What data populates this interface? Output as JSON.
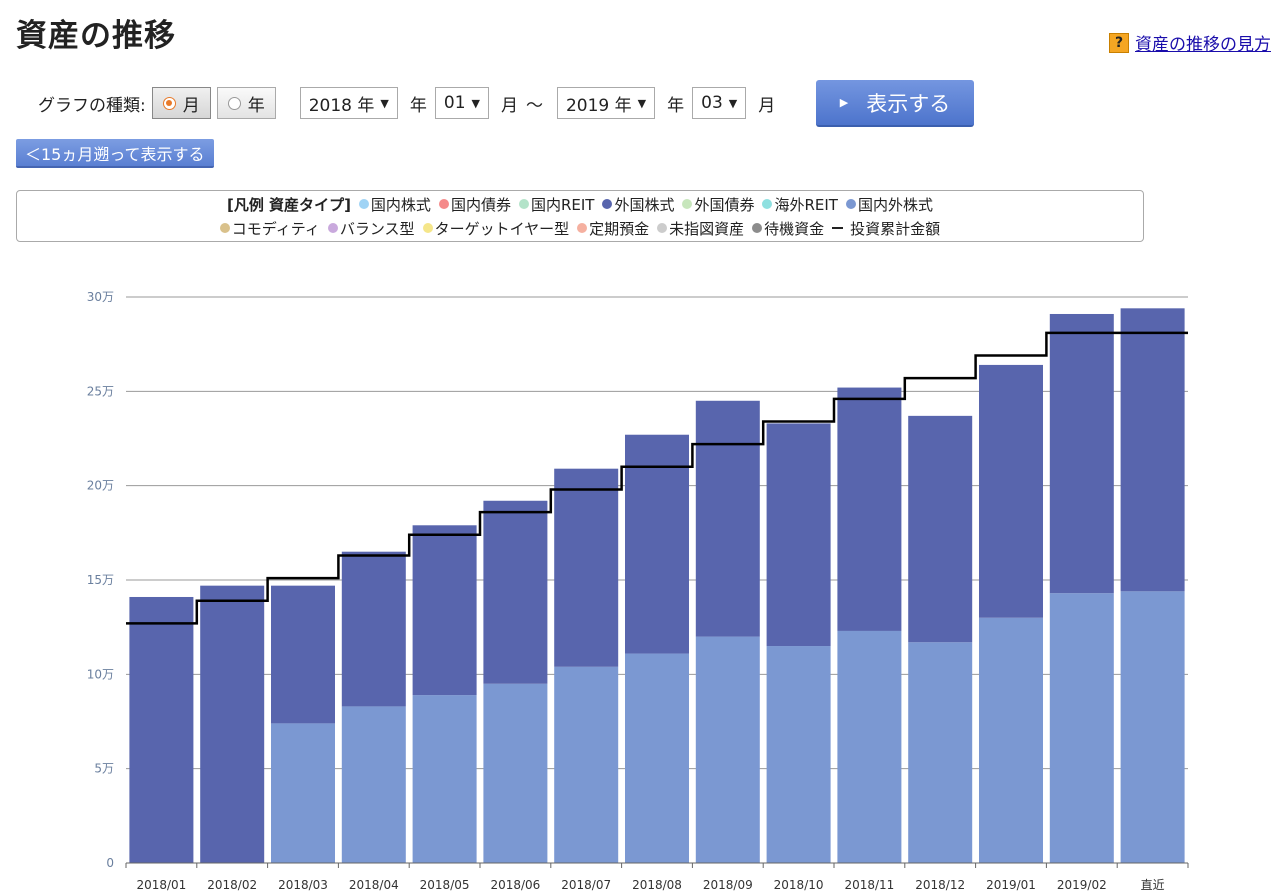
{
  "page": {
    "title": "資産の推移",
    "help_link": "資産の推移の見方",
    "help_icon": "question-icon"
  },
  "controls": {
    "graph_type_label": "グラフの種類:",
    "radio_month": "月",
    "radio_year": "年",
    "selected_type": "月",
    "from_year": "2018 年",
    "from_year_unit": "年",
    "from_month": "01",
    "from_month_unit": "月",
    "range_separator": "～",
    "to_year": "2019 年",
    "to_year_unit": "年",
    "to_month": "03",
    "to_month_unit": "月",
    "show_button": "表示する",
    "back_button": "＜15ヵ月遡って表示する"
  },
  "legend": {
    "title": "[凡例 資産タイプ]",
    "items": [
      {
        "label": "国内株式",
        "color": "#9fd3f5"
      },
      {
        "label": "国内債券",
        "color": "#f58a8a"
      },
      {
        "label": "国内REIT",
        "color": "#b3e3c9"
      },
      {
        "label": "外国株式",
        "color": "#5865ad"
      },
      {
        "label": "外国債券",
        "color": "#c7e6bc"
      },
      {
        "label": "海外REIT",
        "color": "#8fe0e0"
      },
      {
        "label": "国内外株式",
        "color": "#7b98d2"
      },
      {
        "label": "コモディティ",
        "color": "#d9c18b"
      },
      {
        "label": "バランス型",
        "color": "#c9a9dd"
      },
      {
        "label": "ターゲットイヤー型",
        "color": "#f5e68a"
      },
      {
        "label": "定期預金",
        "color": "#f5b0a0"
      },
      {
        "label": "未指図資産",
        "color": "#cccccc"
      },
      {
        "label": "待機資金",
        "color": "#8c8c8c"
      }
    ],
    "line_item": "投資累計金額"
  },
  "chart_data": {
    "type": "bar",
    "stacked": true,
    "categories": [
      "2018/01",
      "2018/02",
      "2018/03",
      "2018/04",
      "2018/05",
      "2018/06",
      "2018/07",
      "2018/08",
      "2018/09",
      "2018/10",
      "2018/11",
      "2018/12",
      "2019/01",
      "2019/02",
      "直近"
    ],
    "series": [
      {
        "name": "国内外株式",
        "color": "#7b98d2",
        "values": [
          0,
          0,
          7.4,
          8.3,
          8.9,
          9.5,
          10.4,
          11.1,
          12.0,
          11.5,
          12.3,
          11.7,
          13.0,
          14.3,
          14.4
        ]
      },
      {
        "name": "外国株式",
        "color": "#5865ad",
        "values": [
          14.1,
          14.7,
          7.3,
          8.2,
          9.0,
          9.7,
          10.5,
          11.6,
          12.5,
          11.8,
          12.9,
          12.0,
          13.4,
          14.8,
          15.0
        ]
      }
    ],
    "line": {
      "name": "投資累計金額",
      "color": "#000000",
      "values": [
        12.7,
        13.9,
        15.1,
        16.3,
        17.4,
        18.6,
        19.8,
        21.0,
        22.2,
        23.4,
        24.6,
        25.7,
        26.9,
        28.1,
        28.1
      ]
    },
    "yticks": [
      "0",
      "5万",
      "10万",
      "15万",
      "20万",
      "25万",
      "30万"
    ],
    "ylim": [
      0,
      30
    ],
    "grid": true
  }
}
